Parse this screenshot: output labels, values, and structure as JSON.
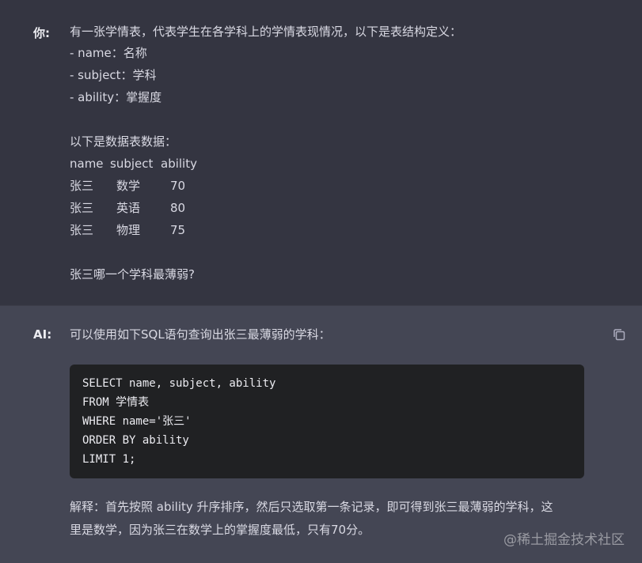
{
  "user_message": {
    "speaker": "你:",
    "intro": "有一张学情表，代表学生在各学科上的学情表现情况，以下是表结构定义：",
    "fields": [
      "- name：名称",
      "- subject：学科",
      "- ability：掌握度"
    ],
    "data_intro": "以下是数据表数据：",
    "table": {
      "headers": [
        "name",
        "subject",
        "ability"
      ],
      "rows": [
        [
          "张三",
          "数学",
          "70"
        ],
        [
          "张三",
          "英语",
          "80"
        ],
        [
          "张三",
          "物理",
          "75"
        ]
      ]
    },
    "question": "张三哪一个学科最薄弱?"
  },
  "ai_message": {
    "speaker": "AI:",
    "intro": "可以使用如下SQL语句查询出张三最薄弱的学科：",
    "copy_icon": "copy-icon",
    "code_lines": [
      "SELECT name, subject, ability",
      "FROM 学情表",
      "WHERE name='张三'",
      "ORDER BY ability",
      "LIMIT 1;"
    ],
    "explanation_lines": [
      "解释：首先按照 ability 升序排序，然后只选取第一条记录，即可得到张三最薄弱的学科，这",
      "里是数学，因为张三在数学上的掌握度最低，只有70分。"
    ]
  },
  "watermark": "@稀土掘金技术社区",
  "colors": {
    "user_bg": "#343541",
    "ai_bg": "#444654",
    "code_bg": "#202123",
    "text": "#d9d9e3"
  }
}
